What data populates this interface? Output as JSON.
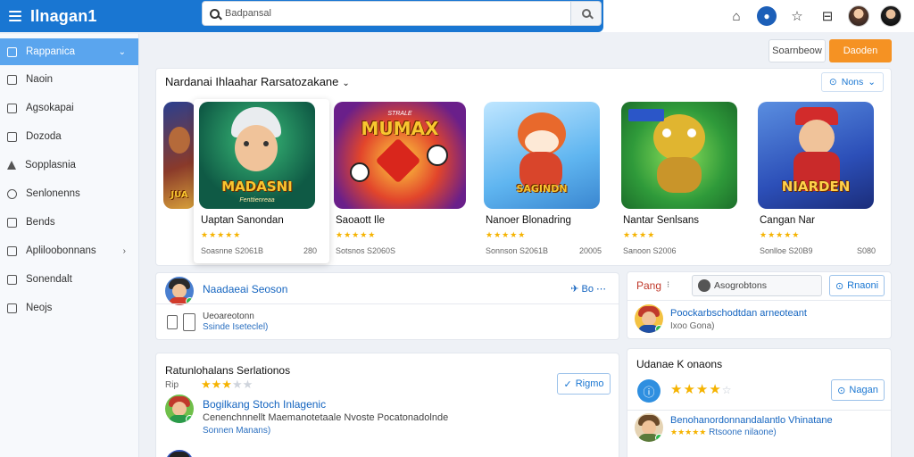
{
  "app": {
    "brand": "Ilnagan1"
  },
  "search": {
    "placeholder": "Badpansal",
    "value": "Badpansal"
  },
  "sidebar": {
    "items": [
      {
        "label": "Rappanica",
        "icon": "phone-icon",
        "active": true
      },
      {
        "label": "Naoin",
        "icon": "home-icon"
      },
      {
        "label": "Agsokapai",
        "icon": "grid-icon"
      },
      {
        "label": "Dozoda",
        "icon": "box-icon"
      },
      {
        "label": "Sopplasnia",
        "icon": "chart-icon"
      },
      {
        "label": "Senlonenns",
        "icon": "clock-icon"
      },
      {
        "label": "Bends",
        "icon": "bookmark-icon"
      },
      {
        "label": "Apliloobonnans",
        "icon": "apps-icon",
        "caret": "›"
      },
      {
        "label": "Sonendalt",
        "icon": "square-icon"
      },
      {
        "label": "Neojs",
        "icon": "doc-icon"
      }
    ]
  },
  "actions": {
    "secondary": "Soarnbeow",
    "primary": "Daoden"
  },
  "featured": {
    "title": "Nardanai Ihlaahar Rarsatozakane",
    "more_label": "Nons",
    "cards": [
      {
        "thumb_text": "",
        "name": "",
        "stars": "★★",
        "meta": "",
        "meta2": ""
      },
      {
        "thumb_text": "MADASNI",
        "thumb_sub": "Fenttienreaa",
        "name": "Uaptan Sanondan",
        "stars": "★★★★★",
        "meta": "Soasnne  S2061B",
        "meta2": "280",
        "raised": true
      },
      {
        "thumb_text": "MUMAX",
        "thumb_sub": "STRALE",
        "name": "Saoaott Ile",
        "stars": "★★★★★",
        "meta": "Sotsnos  S2060S",
        "meta2": ""
      },
      {
        "thumb_text": "SAGINDN",
        "thumb_sub": "",
        "name": "Nanoer Blonadring",
        "stars": "★★★★★",
        "meta": "Sonnson  S2061B",
        "meta2": "20005"
      },
      {
        "thumb_text": "",
        "thumb_sub": "",
        "name": "Nantar Senlsans",
        "stars": "★★★★",
        "meta": "Sanoon  S2006",
        "meta2": ""
      },
      {
        "thumb_text": "NIARDEN",
        "thumb_sub": "",
        "name": "Cangan Nar",
        "stars": "★★★★★",
        "meta": "Sonlloe  S20B9",
        "meta2": "S080"
      }
    ]
  },
  "post1": {
    "author": "Naadaeai Seoson",
    "icons": "✈ Bo ⋯",
    "line1": "Ueoareotonn",
    "line2": "Ssinde Iseteclel)"
  },
  "reply": {
    "label": "Pang",
    "input_value": "Asogrobtons",
    "button": "Rnaoni",
    "author": "Poockarbschodtdan arneoteant",
    "sub": "Ixoo Gona)"
  },
  "post2": {
    "title": "Ratunlohalans Serlationos",
    "rating_label": "Rip",
    "stars": "★★★",
    "stars_empty": "★★",
    "button": "Rigmo",
    "author": "Bogilkang Stoch Inlagenic",
    "body": "Cenenchnnellt Maemanotetaale Nvoste Pocatonadolnde",
    "sub": "Sonnen Manans)"
  },
  "reviews": {
    "title": "Udanae K onaons",
    "stars": "★★★★",
    "stars_empty": "☆",
    "button": "Nagan",
    "author": "Benohanordonnandalantlo Vhinatane",
    "sub": "Rtsoone nilaone)",
    "sub_stars": "★★★★★"
  }
}
